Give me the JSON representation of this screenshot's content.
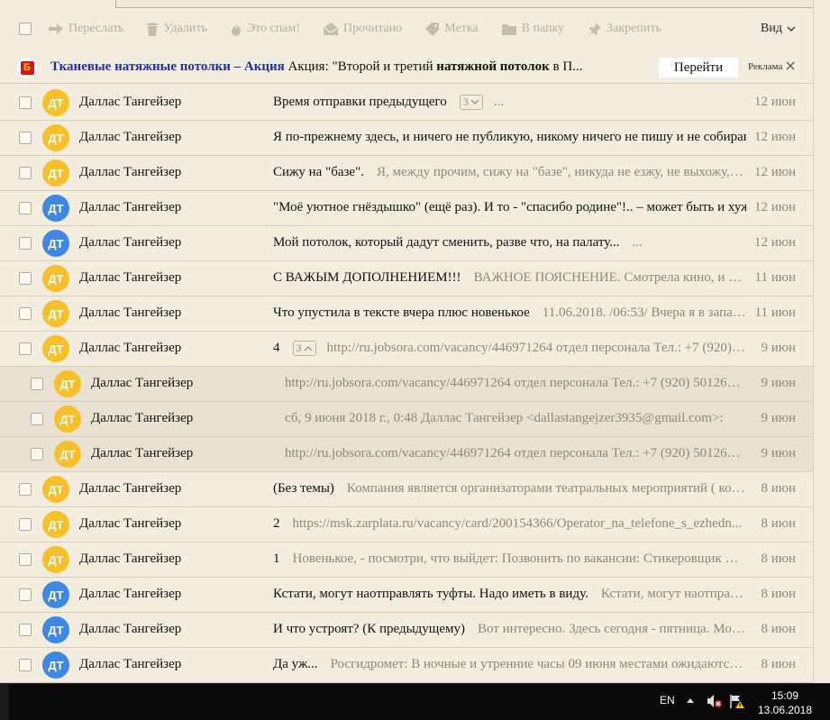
{
  "toolbar": {
    "forward": "Переслать",
    "delete": "Удалить",
    "spam": "Это спам!",
    "read": "Прочитано",
    "label": "Метка",
    "folder": "В папку",
    "pin": "Закрепить",
    "view": "Вид"
  },
  "ad": {
    "logo_letter": "Б",
    "title": "Тканевые натяжные потолки – Акция",
    "text_a": " Акция: \"Второй и третий ",
    "text_bold": "натяжной потолок",
    "text_b": " в П...",
    "button": "Перейти",
    "label": "Реклама"
  },
  "colors": {
    "yellow_avatar": "#f7c02b",
    "blue_avatar": "#3f87e4",
    "ad_title": "#1f2fa3"
  },
  "messages": [
    {
      "initials": "ДТ",
      "color": "yellow",
      "sender": "Даллас Тангейзер",
      "subject": "Время отправки предыдущего",
      "badge": "3",
      "badge_dir": "down",
      "preview": "...",
      "date": "12 июн",
      "sub": false
    },
    {
      "initials": "ДТ",
      "color": "yellow",
      "sender": "Даллас Тангейзер",
      "subject": "Я по-прежнему здесь, и ничего не публикую, никому ничего не пишу и не собираю...",
      "badge": "",
      "preview": "",
      "date": "12 июн",
      "sub": false
    },
    {
      "initials": "ДТ",
      "color": "yellow",
      "sender": "Даллас Тангейзер",
      "subject": "Сижу на \"базе\".",
      "badge": "",
      "preview": "Я, между прочим, сижу на \"базе\", никуда не езжу, не выхожу, ник...",
      "date": "12 июн",
      "sub": false
    },
    {
      "initials": "ДТ",
      "color": "blue",
      "sender": "Даллас Тангейзер",
      "subject": "\"Моё уютное гнёздышко\" (ещё раз). И то - \"спасибо родине\"!.. – может быть и хуже...",
      "badge": "",
      "preview": "",
      "date": "12 июн",
      "sub": false
    },
    {
      "initials": "ДТ",
      "color": "blue",
      "sender": "Даллас Тангейзер",
      "subject": "Мой потолок, который дадут сменить, разве что, на палату...",
      "badge": "",
      "preview": "...",
      "date": "12 июн",
      "sub": false
    },
    {
      "initials": "ДТ",
      "color": "yellow",
      "sender": "Даллас Тангейзер",
      "subject": "С ВАЖЫМ ДОПОЛНЕНИЕМ!!!",
      "badge": "",
      "preview": "ВАЖНОЕ ПОЯСНЕНИЕ. Смотрела кино, и вдруг ...",
      "date": "11 июн",
      "sub": false
    },
    {
      "initials": "ДТ",
      "color": "yellow",
      "sender": "Даллас Тангейзер",
      "subject": "Что упустила в тексте вчера плюс новенькое",
      "badge": "",
      "preview": "11.06.2018. /06:53/ Вчера я в запарке ...",
      "date": "11 июн",
      "sub": false
    },
    {
      "initials": "ДТ",
      "color": "yellow",
      "sender": "Даллас Тангейзер",
      "subject": "4",
      "badge": "3",
      "badge_dir": "up",
      "preview": "http://ru.jobsora.com/vacancy/446971264 отдел персонала Тел.: +7 (920) 50...",
      "date": "9 июн",
      "sub": false
    },
    {
      "initials": "ДТ",
      "color": "yellow",
      "sender": "Даллас Тангейзер",
      "subject": "",
      "badge": "",
      "preview": "http://ru.jobsora.com/vacancy/446971264 отдел персонала Тел.: +7 (920) 5012669 ...",
      "date": "9 июн",
      "sub": true
    },
    {
      "initials": "ДТ",
      "color": "yellow",
      "sender": "Даллас Тангейзер",
      "subject": "",
      "badge": "",
      "preview": "сб, 9 июня 2018 г., 0:48 Даллас Тангейзер <dallastangejzer3935@gmail.com>:",
      "date": "9 июн",
      "sub": true
    },
    {
      "initials": "ДТ",
      "color": "yellow",
      "sender": "Даллас Тангейзер",
      "subject": "",
      "badge": "",
      "preview": "http://ru.jobsora.com/vacancy/446971264 отдел персонала Тел.: +7 (920) 5012669 ...",
      "date": "9 июн",
      "sub": true
    },
    {
      "initials": "ДТ",
      "color": "yellow",
      "sender": "Даллас Тангейзер",
      "subject": "(Без темы)",
      "badge": "",
      "preview": "Компания является организаторами театральных мероприятий ( конц...",
      "date": "8 июн",
      "sub": false
    },
    {
      "initials": "ДТ",
      "color": "yellow",
      "sender": "Даллас Тангейзер",
      "subject": "2",
      "badge": "",
      "preview": "https://msk.zarplata.ru/vacancy/card/200154366/Operator_na_telefone_s_ezhedn...",
      "date": "8 июн",
      "sub": false
    },
    {
      "initials": "ДТ",
      "color": "yellow",
      "sender": "Даллас Тангейзер",
      "subject": "1",
      "badge": "",
      "preview": "Новенькое, - посмотри, что выйдет: Позвонить по вакансии: Стикеровщик Конт...",
      "date": "8 июн",
      "sub": false
    },
    {
      "initials": "ДТ",
      "color": "blue",
      "sender": "Даллас Тангейзер",
      "subject": "Кстати, могут наотправлять туфты. Надо иметь в виду.",
      "badge": "",
      "preview": "Кстати, могут наотправлят...",
      "date": "8 июн",
      "sub": false
    },
    {
      "initials": "ДТ",
      "color": "blue",
      "sender": "Даллас Тангейзер",
      "subject": "И что устроят? (К предыдущему)",
      "badge": "",
      "preview": "Вот интересно. Здесь сегодня - пятница. Могут п...",
      "date": "8 июн",
      "sub": false
    },
    {
      "initials": "ДТ",
      "color": "blue",
      "sender": "Даллас Тангейзер",
      "subject": "Да уж...",
      "badge": "",
      "preview": "Росгидромет: В ночные и утренние часы 09 июня местами ожидаются ЗА...",
      "date": "8 июн",
      "sub": false
    }
  ],
  "taskbar": {
    "lang": "EN",
    "time": "15:09",
    "date": "13.06.2018"
  }
}
